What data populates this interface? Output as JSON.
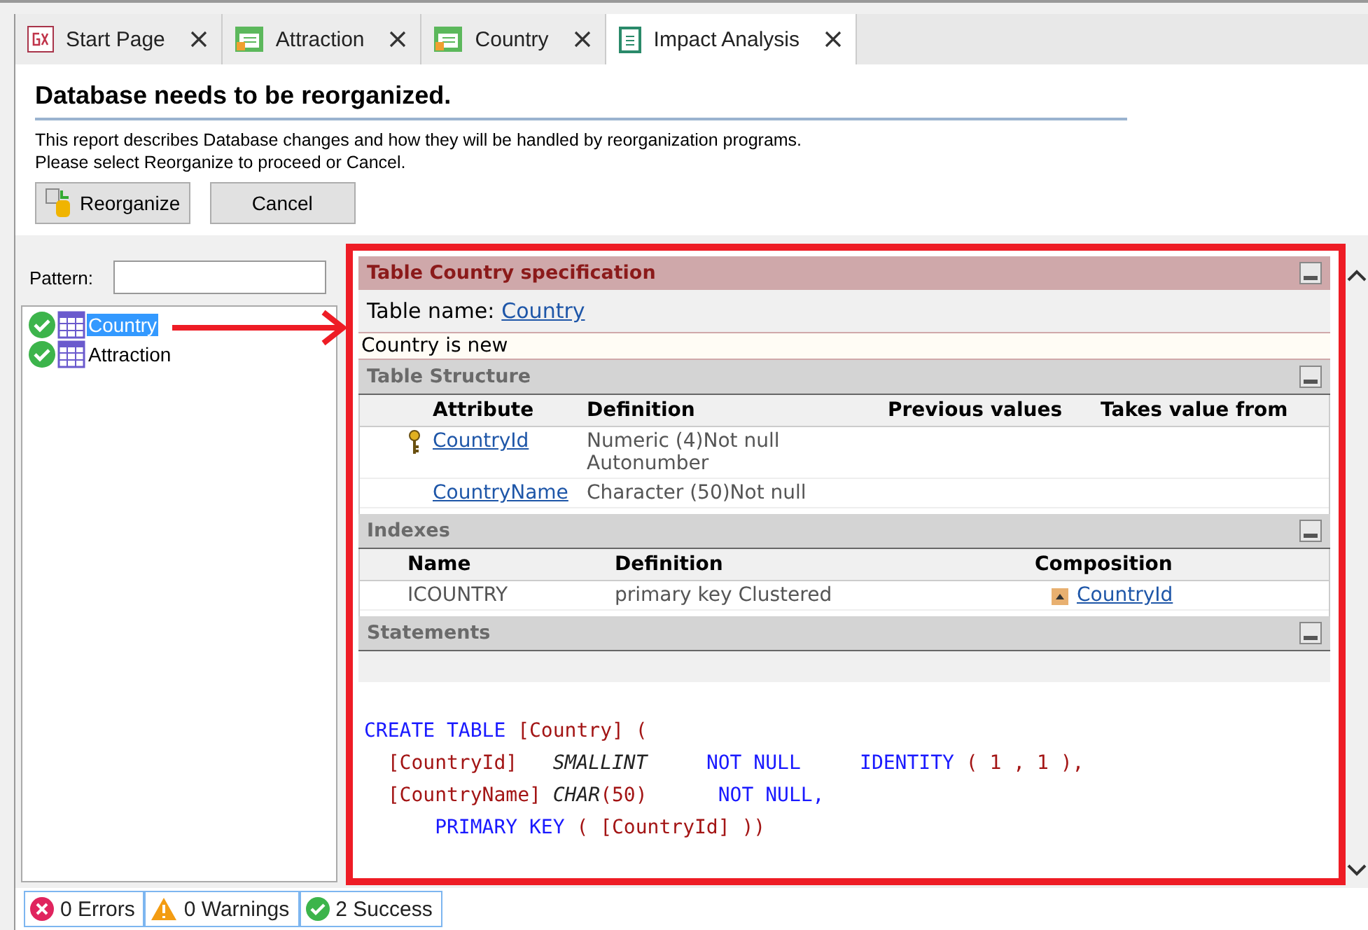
{
  "tabs": [
    {
      "label": "Start Page",
      "kind": "start",
      "selected": false
    },
    {
      "label": "Attraction",
      "kind": "object",
      "selected": false
    },
    {
      "label": "Country",
      "kind": "object",
      "selected": false
    },
    {
      "label": "Impact Analysis",
      "kind": "report",
      "selected": true
    }
  ],
  "header": {
    "title": "Database needs to be reorganized.",
    "description": [
      "This report describes Database changes and how they will be handled by reorganization programs.",
      "Please select Reorganize to proceed or Cancel."
    ],
    "buttons": [
      {
        "label": "Reorganize",
        "kind": "reorganize"
      },
      {
        "label": "Cancel",
        "kind": "plain"
      }
    ]
  },
  "sidebar": {
    "pattern_label": "Pattern:",
    "items": [
      {
        "label": "Country",
        "selected": true
      },
      {
        "label": "Attraction",
        "selected": false
      }
    ]
  },
  "report": {
    "title": "Table Country specification",
    "table_name_label": "Table name:",
    "table_name": "Country",
    "note": "Country is new",
    "structure": {
      "title": "Table Structure",
      "columns": [
        "Attribute",
        "Definition",
        "Previous values",
        "Takes value from"
      ],
      "rows": [
        {
          "key": true,
          "attribute": "CountryId",
          "definition": [
            "Numeric (4)Not null",
            "Autonumber"
          ]
        },
        {
          "key": false,
          "attribute": "CountryName",
          "definition": [
            "Character (50)Not null"
          ]
        }
      ]
    },
    "indexes": {
      "title": "Indexes",
      "columns": [
        "Name",
        "Definition",
        "Composition"
      ],
      "rows": [
        {
          "name": "ICOUNTRY",
          "definition": "primary key Clustered",
          "composition": "CountryId"
        }
      ]
    },
    "statements": {
      "title": "Statements",
      "lines": [
        [
          {
            "t": "CREATE TABLE ",
            "kind": "kw"
          },
          {
            "t": "[Country] (",
            "kind": "id"
          }
        ],
        [
          {
            "t": "  [CountryId]   ",
            "kind": "id"
          },
          {
            "t": "SMALLINT",
            "kind": "type"
          },
          {
            "t": "     NOT NULL",
            "kind": "kw"
          },
          {
            "t": "     IDENTITY ",
            "kind": "kw"
          },
          {
            "t": "( 1 , 1 ),",
            "kind": "id"
          }
        ],
        [
          {
            "t": "  [CountryName] ",
            "kind": "id"
          },
          {
            "t": "CHAR",
            "kind": "type"
          },
          {
            "t": "(50)",
            "kind": "id"
          },
          {
            "t": "      NOT NULL,",
            "kind": "kw"
          }
        ],
        [
          {
            "t": "      PRIMARY KEY ",
            "kind": "kw"
          },
          {
            "t": "( [CountryId] ))",
            "kind": "id"
          }
        ]
      ]
    }
  },
  "status_bar": [
    {
      "kind": "error",
      "label": "0 Errors"
    },
    {
      "kind": "warning",
      "label": "0 Warnings"
    },
    {
      "kind": "success",
      "label": "2 Success"
    }
  ]
}
